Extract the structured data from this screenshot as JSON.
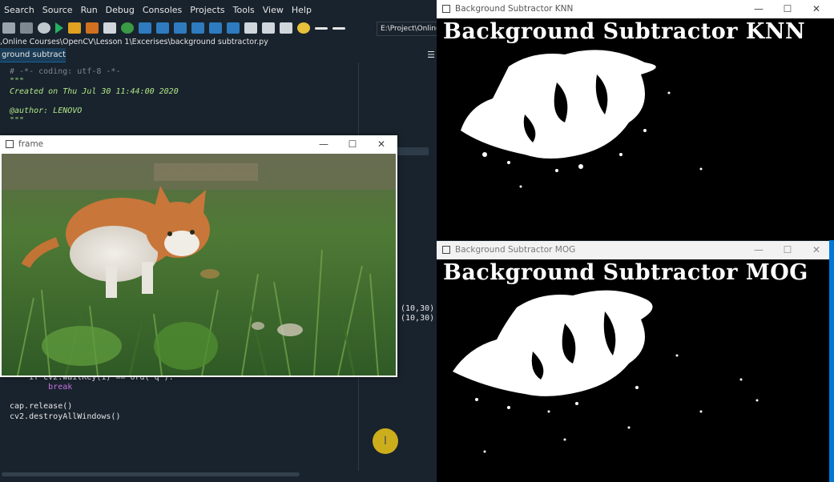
{
  "ide": {
    "menu": [
      "Search",
      "Source",
      "Run",
      "Debug",
      "Consoles",
      "Projects",
      "Tools",
      "View",
      "Help"
    ],
    "path_box": "E:\\Project\\Online Co",
    "file_path": ",Online Courses\\OpenCV\\Lesson 1\\Excerises\\background subtractor.py",
    "tab_label": "ground subtractor.py",
    "tab_menu_icon": "hamburger-icon",
    "code_top": {
      "line1": "# -*- coding: utf-8 -*-",
      "line2": "\"\"\"",
      "line3": "Created on Thu Jul 30 11:44:00 2020",
      "line4": "@author: LENOVO",
      "line5": "\"\"\""
    },
    "code_bottom": {
      "line1": "    if cv2.waitKey(1) == ord('q'):",
      "line2": "        break",
      "line3": "cap.release()",
      "line4": "cv2.destroyAllWindows()"
    },
    "code_right": [
      "(10,30)",
      "(10,30)"
    ],
    "colors": {
      "bg": "#19232d",
      "accent": "#1464a0",
      "cursor": "#d6b61c"
    }
  },
  "frame_window": {
    "title": "frame"
  },
  "knn_window": {
    "title": "Background Subtractor KNN",
    "overlay_text": "Background Subtractor KNN"
  },
  "mog_window": {
    "title": "Background Subtractor MOG",
    "overlay_text": "Background Subtractor MOG"
  },
  "window_controls": {
    "minimize": "—",
    "maximize": "☐",
    "close": "✕"
  }
}
